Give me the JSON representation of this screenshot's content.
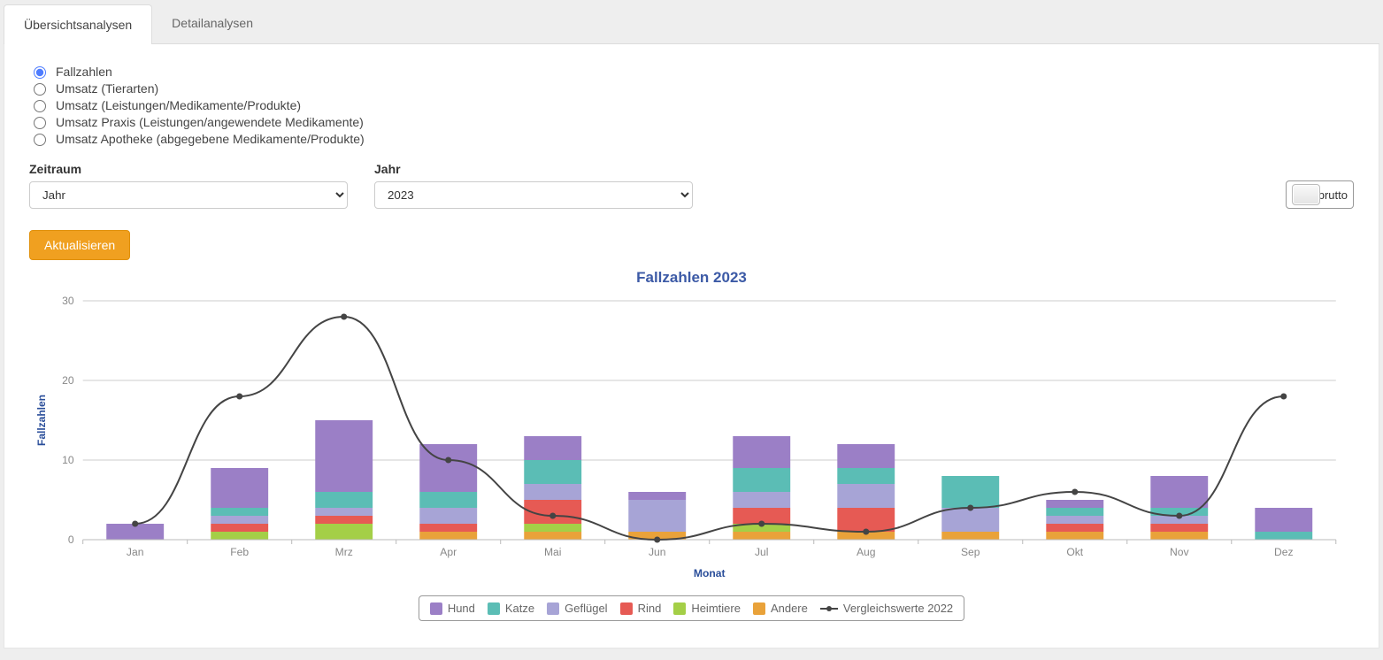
{
  "tabs": {
    "overview": "Übersichtsanalysen",
    "detail": "Detailanalysen"
  },
  "radios": {
    "fallzahlen": "Fallzahlen",
    "umsatz_tier": "Umsatz (Tierarten)",
    "umsatz_lmp": "Umsatz (Leistungen/Medikamente/Produkte)",
    "umsatz_praxis": "Umsatz Praxis (Leistungen/angewendete Medikamente)",
    "umsatz_apotheke": "Umsatz Apotheke (abgegebene Medikamente/Produkte)"
  },
  "filters": {
    "period_label": "Zeitraum",
    "period_value": "Jahr",
    "year_label": "Jahr",
    "year_value": "2023"
  },
  "toggle": {
    "label": "brutto"
  },
  "buttons": {
    "refresh": "Aktualisieren"
  },
  "chart_data": {
    "type": "bar",
    "title": "Fallzahlen 2023",
    "xlabel": "Monat",
    "ylabel": "Fallzahlen",
    "ylim": [
      0,
      30
    ],
    "yticks": [
      0,
      10,
      20,
      30
    ],
    "categories": [
      "Jan",
      "Feb",
      "Mrz",
      "Apr",
      "Mai",
      "Jun",
      "Jul",
      "Aug",
      "Sep",
      "Okt",
      "Nov",
      "Dez"
    ],
    "series": [
      {
        "name": "Hund",
        "color": "#9b7fc6",
        "values": [
          2,
          5,
          9,
          6,
          3,
          1,
          4,
          3,
          0,
          1,
          4,
          3
        ]
      },
      {
        "name": "Katze",
        "color": "#5bbdb5",
        "values": [
          0,
          1,
          2,
          2,
          3,
          0,
          3,
          2,
          4,
          1,
          1,
          1
        ]
      },
      {
        "name": "Geflügel",
        "color": "#a7a4d6",
        "values": [
          0,
          1,
          1,
          2,
          2,
          4,
          2,
          3,
          3,
          1,
          1,
          0
        ]
      },
      {
        "name": "Rind",
        "color": "#e65a54",
        "values": [
          0,
          1,
          1,
          1,
          3,
          0,
          2,
          3,
          0,
          1,
          1,
          0
        ]
      },
      {
        "name": "Heimtiere",
        "color": "#a4cf47",
        "values": [
          0,
          1,
          2,
          0,
          1,
          0,
          1,
          0,
          0,
          0,
          0,
          0
        ]
      },
      {
        "name": "Andere",
        "color": "#e9a23a",
        "values": [
          0,
          0,
          0,
          1,
          1,
          1,
          1,
          1,
          1,
          1,
          1,
          0
        ]
      }
    ],
    "comparison": {
      "name": "Vergleichswerte 2022",
      "color": "#444444",
      "values": [
        2,
        18,
        28,
        10,
        3,
        0,
        2,
        1,
        4,
        6,
        3,
        18
      ]
    }
  },
  "legend": {
    "hund": "Hund",
    "katze": "Katze",
    "gefluegel": "Geflügel",
    "rind": "Rind",
    "heimtiere": "Heimtiere",
    "andere": "Andere",
    "vergleich": "Vergleichswerte 2022"
  }
}
